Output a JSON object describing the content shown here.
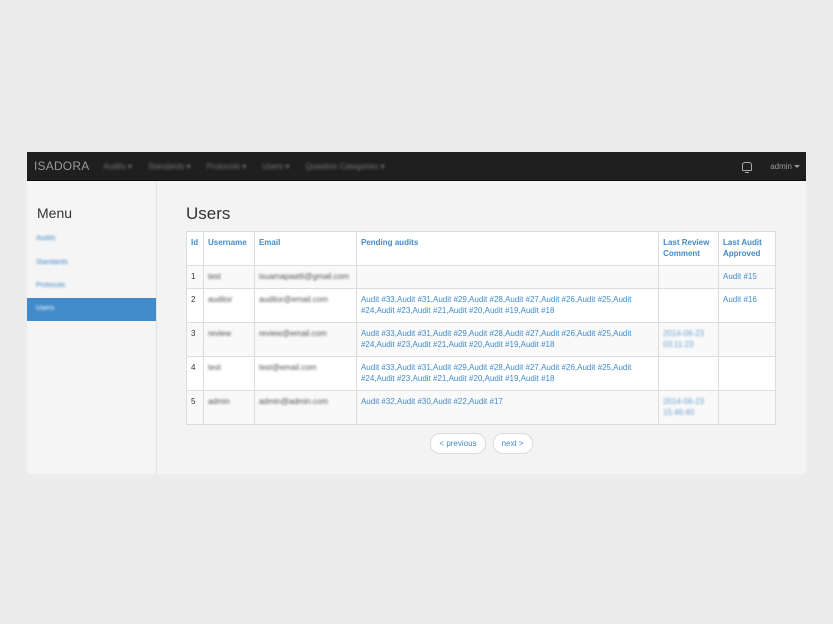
{
  "navbar": {
    "brand": "ISADORA",
    "items": [
      {
        "label": "Audits"
      },
      {
        "label": "Standards"
      },
      {
        "label": "Protocols"
      },
      {
        "label": "Users"
      },
      {
        "label": "Question Categories"
      }
    ],
    "user_label": "admin"
  },
  "sidebar": {
    "title": "Menu",
    "items": [
      {
        "label": "Audits"
      },
      {
        "label": "Standards"
      },
      {
        "label": "Protocols"
      },
      {
        "label": "Users",
        "active": true
      }
    ]
  },
  "main": {
    "title": "Users",
    "table": {
      "headers": [
        "Id",
        "Username",
        "Email",
        "Pending audits",
        "Last Review Comment",
        "Last Audit Approved"
      ],
      "rows": [
        {
          "id": "1",
          "username": "test",
          "email": "isuamapaatti@gmail.com",
          "pending": "",
          "comment": "",
          "approved": "Audit #15"
        },
        {
          "id": "2",
          "username": "auditor",
          "email": "auditor@email.com",
          "pending": "Audit #33,Audit #31,Audit #29,Audit #28,Audit #27,Audit #26,Audit #25,Audit #24,Audit #23,Audit #21,Audit #20,Audit #19,Audit #18",
          "comment": "",
          "approved": "Audit #16"
        },
        {
          "id": "3",
          "username": "review",
          "email": "review@email.com",
          "pending": "Audit #33,Audit #31,Audit #29,Audit #28,Audit #27,Audit #26,Audit #25,Audit #24,Audit #23,Audit #21,Audit #20,Audit #19,Audit #18",
          "comment": "2014-06-23 03:11:23",
          "approved": ""
        },
        {
          "id": "4",
          "username": "test",
          "email": "test@email.com",
          "pending": "Audit #33,Audit #31,Audit #29,Audit #28,Audit #27,Audit #26,Audit #25,Audit #24,Audit #23,Audit #21,Audit #20,Audit #19,Audit #18",
          "comment": "",
          "approved": ""
        },
        {
          "id": "5",
          "username": "admin",
          "email": "admin@admin.com",
          "pending": "Audit #32,Audit #30,Audit #22,Audit #17",
          "comment": "2014-06-23 15:46:40",
          "approved": ""
        }
      ]
    },
    "pager": {
      "previous": "< previous",
      "next": "next >"
    }
  },
  "colors": {
    "accent": "#428bca",
    "navbar_bg": "#1f1f1f",
    "page_bg": "#ececec"
  }
}
